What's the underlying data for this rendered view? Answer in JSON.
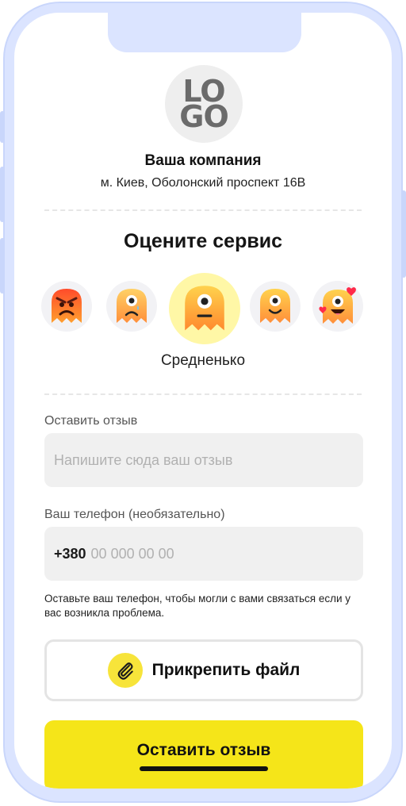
{
  "logo": {
    "line1": "LO",
    "line2": "GO"
  },
  "company": {
    "name": "Ваша компания",
    "address": "м. Киев, Оболонский проспект 16В"
  },
  "rating": {
    "title": "Оцените сервис",
    "emojis": [
      {
        "name": "angry-face-icon",
        "selected": false
      },
      {
        "name": "sad-face-icon",
        "selected": false
      },
      {
        "name": "neutral-face-icon",
        "selected": true
      },
      {
        "name": "happy-face-icon",
        "selected": false
      },
      {
        "name": "love-face-icon",
        "selected": false
      }
    ],
    "selected_label": "Средненько"
  },
  "review": {
    "label": "Оставить отзыв",
    "placeholder": "Напишите сюда ваш отзыв"
  },
  "phone": {
    "label": "Ваш телефон (необязательно)",
    "prefix": "+380",
    "placeholder": "00 000 00 00",
    "hint": "Оставьте ваш телефон, чтобы могли с вами связаться если у вас возникла проблема."
  },
  "attach": {
    "label": "Прикрепить файл"
  },
  "submit": {
    "label": "Оставить отзыв"
  },
  "colors": {
    "accent": "#f5e519",
    "frame": "#dbe4ff",
    "field_bg": "#f0f0f0"
  }
}
